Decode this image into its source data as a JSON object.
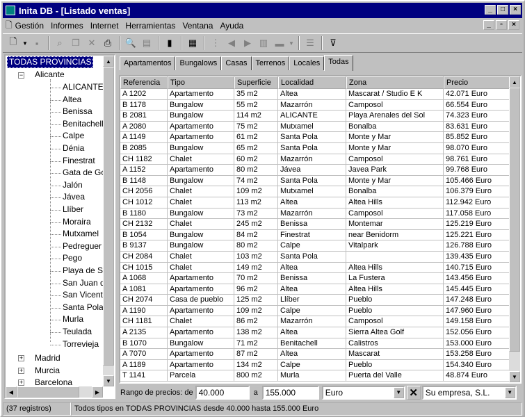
{
  "window": {
    "title": "Inita DB - [Listado ventas]"
  },
  "menu": [
    "Gestión",
    "Informes",
    "Internet",
    "Herramientas",
    "Ventana",
    "Ayuda"
  ],
  "tree": {
    "root": "TODAS PROVINCIAS",
    "alicante": "Alicante",
    "towns": [
      "ALICANTE",
      "Altea",
      "Benissa",
      "Benitachell",
      "Calpe",
      "Dénia",
      "Finestrat",
      "Gata de Gorg",
      "Jalón",
      "Jávea",
      "Llíber",
      "Moraira",
      "Mutxamel",
      "Pedreguer",
      "Pego",
      "Playa de San",
      "San Juan de",
      "San Vicente",
      "Santa Pola",
      "Murla",
      "Teulada",
      "Torrevieja"
    ],
    "others": [
      "Madrid",
      "Murcia",
      "Barcelona"
    ]
  },
  "tabs": [
    "Apartamentos",
    "Bungalows",
    "Casas",
    "Terrenos",
    "Locales",
    "Todas"
  ],
  "grid": {
    "headers": [
      "Referencia",
      "Tipo",
      "Superficie",
      "Localidad",
      "Zona",
      "Precio"
    ],
    "rows": [
      [
        "A 1202",
        "Apartamento",
        "35 m2",
        "Altea",
        "Mascarat / Studio  E  K",
        "42.071 Euro"
      ],
      [
        "B 1178",
        "Bungalow",
        "55 m2",
        "Mazarrón",
        "Camposol",
        "66.554 Euro"
      ],
      [
        "B 2081",
        "Bungalow",
        "114 m2",
        "ALICANTE",
        "Playa Arenales del Sol",
        "74.323 Euro"
      ],
      [
        "A 2080",
        "Apartamento",
        "75 m2",
        "Mutxamel",
        "Bonalba",
        "83.631 Euro"
      ],
      [
        "A 1149",
        "Apartamento",
        "61 m2",
        "Santa Pola",
        "Monte y Mar",
        "85.852 Euro"
      ],
      [
        "B 2085",
        "Bungalow",
        "65 m2",
        "Santa Pola",
        "Monte y Mar",
        "98.070 Euro"
      ],
      [
        "CH 1182",
        "Chalet",
        "60 m2",
        "Mazarrón",
        "Camposol",
        "98.761 Euro"
      ],
      [
        "A 1152",
        "Apartamento",
        "80 m2",
        "Jávea",
        "Javea Park",
        "99.768 Euro"
      ],
      [
        "B 1148",
        "Bungalow",
        "74 m2",
        "Santa Pola",
        "Monte y Mar",
        "105.466 Euro"
      ],
      [
        "CH 2056",
        "Chalet",
        "109 m2",
        "Mutxamel",
        "Bonalba",
        "106.379 Euro"
      ],
      [
        "CH 1012",
        "Chalet",
        "113 m2",
        "Altea",
        "Altea Hills",
        "112.942 Euro"
      ],
      [
        "B 1180",
        "Bungalow",
        "73 m2",
        "Mazarrón",
        "Camposol",
        "117.058 Euro"
      ],
      [
        "CH 2132",
        "Chalet",
        "245 m2",
        "Benissa",
        "Montemar",
        "125.219 Euro"
      ],
      [
        "B 1054",
        "Bungalow",
        "84 m2",
        "Finestrat",
        "near Benidorm",
        "125.221 Euro"
      ],
      [
        "B 9137",
        "Bungalow",
        "80 m2",
        "Calpe",
        "Vitalpark",
        "126.788 Euro"
      ],
      [
        "CH 2084",
        "Chalet",
        "103 m2",
        "Santa Pola",
        "",
        "139.435 Euro"
      ],
      [
        "CH 1015",
        "Chalet",
        "149 m2",
        "Altea",
        "Altea Hills",
        "140.715 Euro"
      ],
      [
        "A 1068",
        "Apartamento",
        "70 m2",
        "Benissa",
        "La Fustera",
        "143.456 Euro"
      ],
      [
        "A 1081",
        "Apartamento",
        "96 m2",
        "Altea",
        "Altea Hills",
        "145.445 Euro"
      ],
      [
        "CH 2074",
        "Casa de pueblo",
        "125 m2",
        "Llíber",
        "Pueblo",
        "147.248 Euro"
      ],
      [
        "A 1190",
        "Apartamento",
        "109 m2",
        "Calpe",
        "Pueblo",
        "147.960 Euro"
      ],
      [
        "CH 1181",
        "Chalet",
        "86 m2",
        "Mazarrón",
        "Camposol",
        "149.158 Euro"
      ],
      [
        "A 2135",
        "Apartamento",
        "138 m2",
        "Altea",
        "Sierra Altea Golf",
        "152.056 Euro"
      ],
      [
        "B 1070",
        "Bungalow",
        "71 m2",
        "Benitachell",
        "Calistros",
        "153.000 Euro"
      ],
      [
        "A 7070",
        "Apartamento",
        "87 m2",
        "Altea",
        "Mascarat",
        "153.258 Euro"
      ],
      [
        "A 1189",
        "Apartamento",
        "134 m2",
        "Calpe",
        "Pueblo",
        "154.340 Euro"
      ],
      [
        "T 1141",
        "Parcela",
        "800 m2",
        "Murla",
        "Puerta del Valle",
        "48.874 Euro"
      ]
    ]
  },
  "filter": {
    "label": "Rango de precios: de",
    "from": "40.000",
    "to_label": "a",
    "to": "155.000",
    "currency": "Euro",
    "company": "Su empresa, S.L."
  },
  "status": {
    "count": "(37 registros)",
    "description": "Todos tipos en TODAS PROVINCIAS  desde 40.000 hasta 155.000 Euro"
  }
}
